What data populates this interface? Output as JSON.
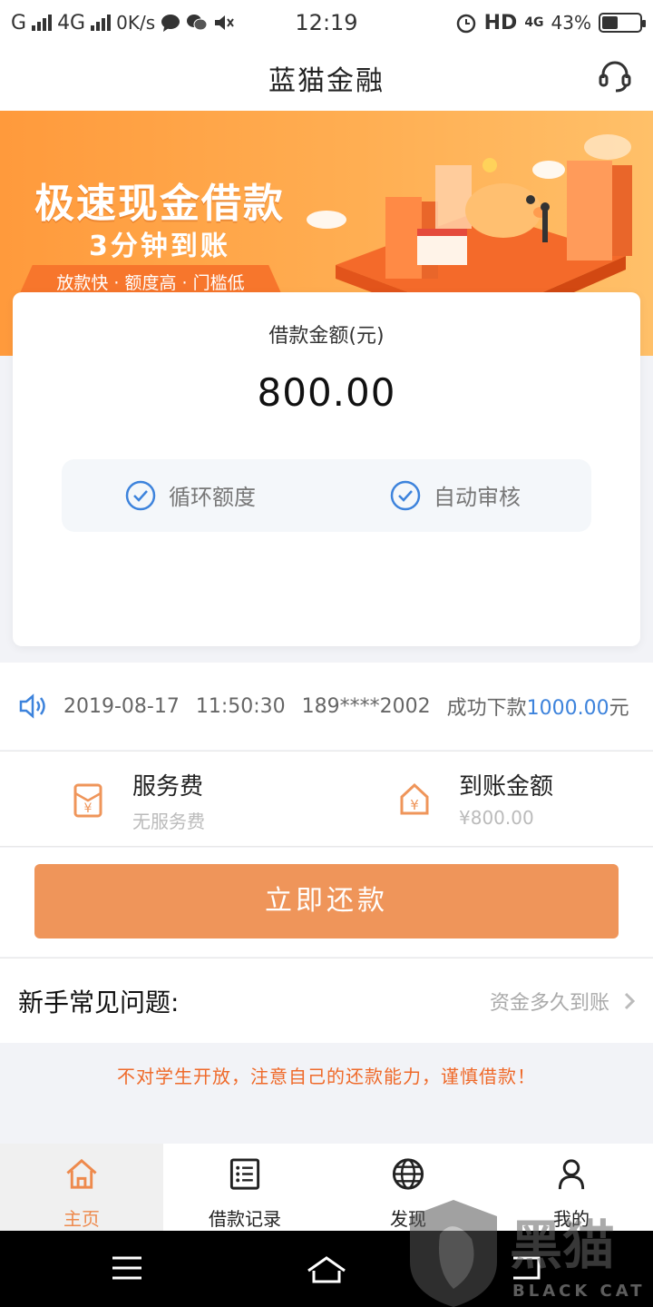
{
  "status_bar": {
    "carrier_1": "G",
    "carrier_2": "4G",
    "speed": "0K/s",
    "time": "12:19",
    "hd": "HD",
    "net_2": "4G",
    "battery_text": "43%",
    "battery_level": 0.43
  },
  "header": {
    "title": "蓝猫金融"
  },
  "banner": {
    "headline": "极速现金借款",
    "subheadline": "3分钟到账",
    "tagline": "放款快 · 额度高 · 门槛低"
  },
  "loan_card": {
    "amount_label": "借款金额(元)",
    "amount_value": "800.00",
    "features": [
      "循环额度",
      "自动审核"
    ]
  },
  "ticker": {
    "date": "2019-08-17",
    "time": "11:50:30",
    "phone": "189****2002",
    "prefix": "成功下款",
    "amount": "1000.00",
    "unit": "元"
  },
  "info": {
    "fee_title": "服务费",
    "fee_sub": "无服务费",
    "received_title": "到账金额",
    "received_sub": "¥800.00"
  },
  "repay_button": "立即还款",
  "faq": {
    "title": "新手常见问题:",
    "link": "资金多久到账"
  },
  "warning": "不对学生开放，注意自己的还款能力，谨慎借款！",
  "tabs": [
    {
      "label": "主页",
      "icon": "home-icon",
      "active": true
    },
    {
      "label": "借款记录",
      "icon": "list-icon",
      "active": false
    },
    {
      "label": "发现",
      "icon": "globe-icon",
      "active": false
    },
    {
      "label": "我的",
      "icon": "person-icon",
      "active": false
    }
  ],
  "watermark": {
    "brand": "黑猫",
    "brand_en": "BLACK CAT"
  },
  "colors": {
    "accent": "#ef955a",
    "blue": "#3d83dc",
    "warning": "#ef6a2a",
    "banner": "#ff9a3c"
  }
}
